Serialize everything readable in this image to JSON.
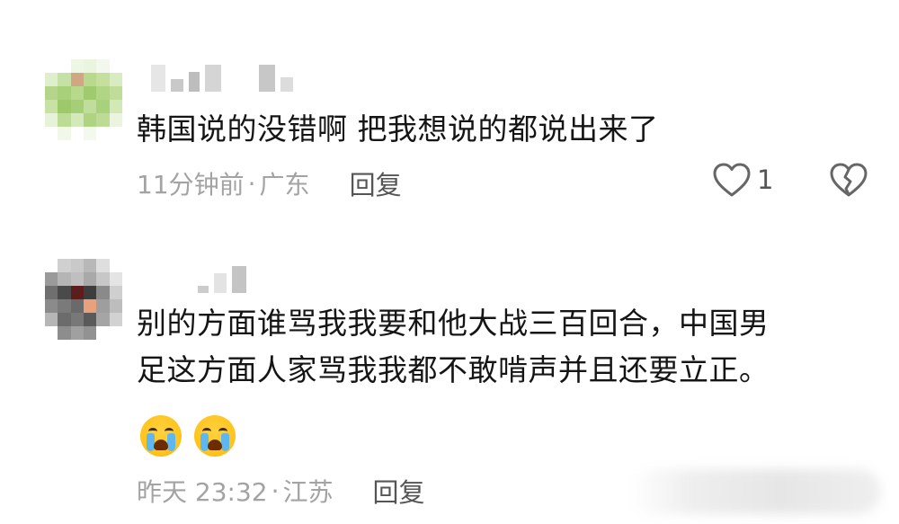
{
  "comments": [
    {
      "text": "韩国说的没错啊 把我想说的都说出来了",
      "time": "11分钟前",
      "separator": "·",
      "location": "广东",
      "reply_label": "回复",
      "like_count": "1",
      "icons": {
        "like": "heart-outline-icon",
        "dislike": "broken-heart-icon"
      }
    },
    {
      "text": "别的方面谁骂我我要和他大战三百回合，中国男\n足这方面人家骂我我都不敢啃声并且还要立正。",
      "time": "昨天 23:32",
      "separator": "·",
      "location": "江苏",
      "reply_label": "回复",
      "emojis": [
        "crying-face-emoji",
        "crying-face-emoji"
      ]
    }
  ],
  "colors": {
    "text": "#151515",
    "meta": "#a3a3a3",
    "action": "#555555",
    "background": "#ffffff"
  }
}
